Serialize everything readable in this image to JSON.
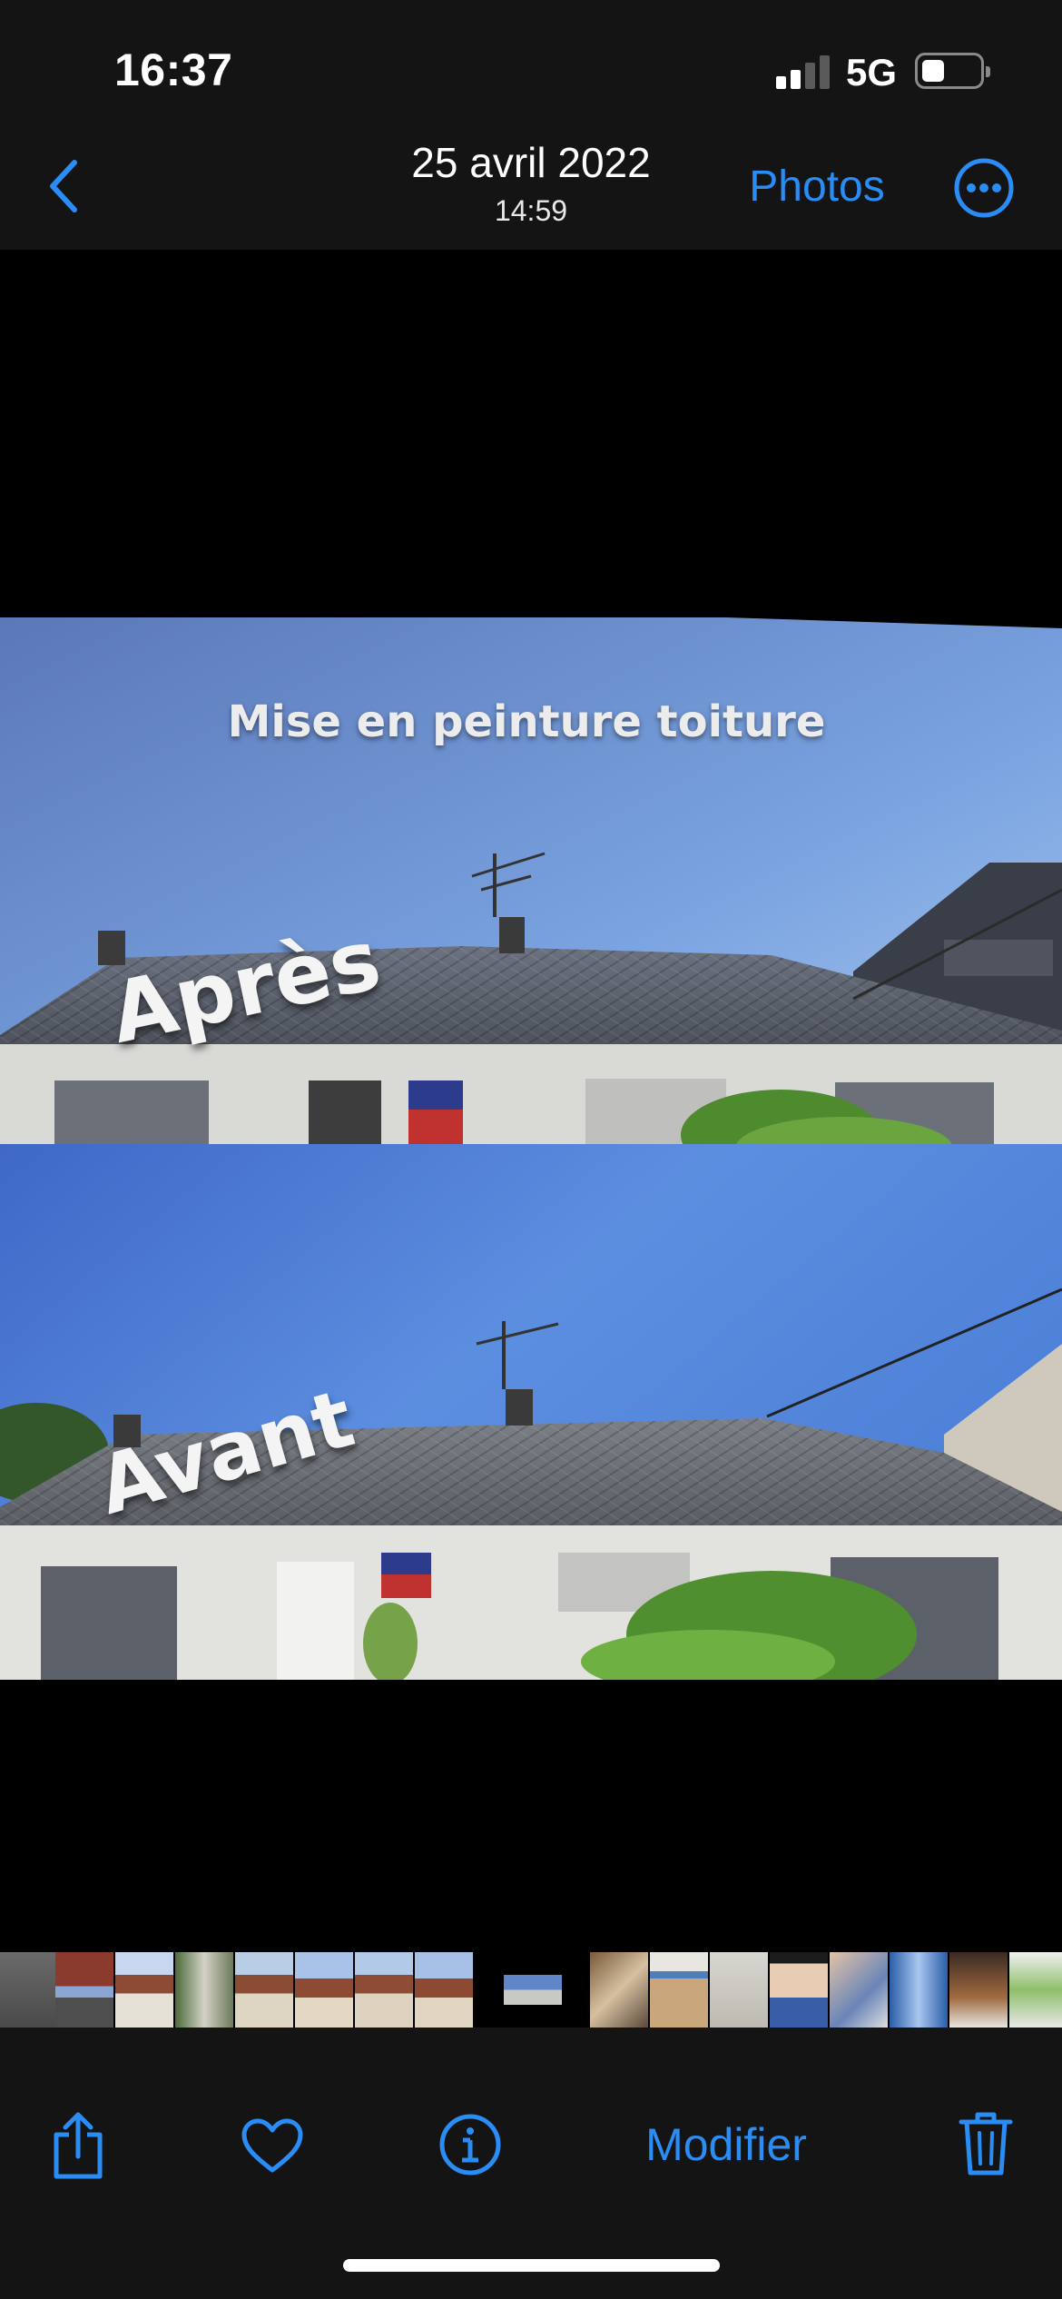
{
  "status_bar": {
    "time": "16:37",
    "network": "5G",
    "signal_bars": 2,
    "battery_level": 0.3
  },
  "nav": {
    "back_icon": "chevron-left-icon",
    "date": "25 avril 2022",
    "time": "14:59",
    "photos_label": "Photos",
    "more_icon": "ellipsis-circle-icon"
  },
  "photo": {
    "caption": "Mise en peinture toiture",
    "label_top": "Après",
    "label_bottom": "Avant"
  },
  "toolbar": {
    "share_icon": "share-icon",
    "favorite_icon": "heart-icon",
    "info_icon": "info-icon",
    "edit_label": "Modifier",
    "delete_icon": "trash-icon"
  },
  "colors": {
    "accent": "#2a8cf5",
    "bar_background": "#141414"
  }
}
